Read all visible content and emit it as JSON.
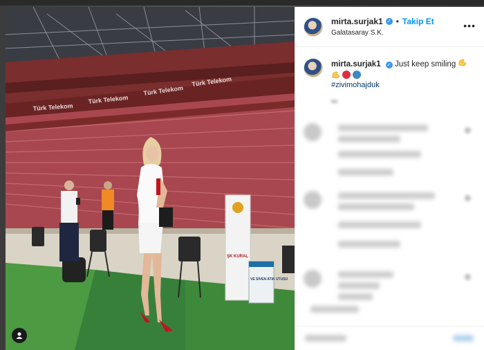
{
  "post": {
    "username": "mirta.surjak1",
    "verified_mark": "✓",
    "follow_label": "Takip Et",
    "location": "Galatasaray S.K.",
    "more_label": "•••",
    "caption_text": "Just keep smiling",
    "hashtag": "#zivimohajduk",
    "icons": [
      "verified-badge-icon",
      "more-options-icon",
      "user-tag-icon",
      "flexed-biceps-emoji",
      "red-circle-emoji",
      "blue-circle-emoji"
    ],
    "colors": {
      "accent": "#0095f6",
      "verified": "#3897f0",
      "hashtag": "#00376b",
      "red_circle": "#dd2e44",
      "blue_circle": "#3b88c3",
      "biceps": "#ffcc4d"
    }
  },
  "photo": {
    "banner_text": "Türk Telekom",
    "sign_text": "ŞK KURAL",
    "bin_text": "VE SİVEN ATIK UTUSU"
  }
}
